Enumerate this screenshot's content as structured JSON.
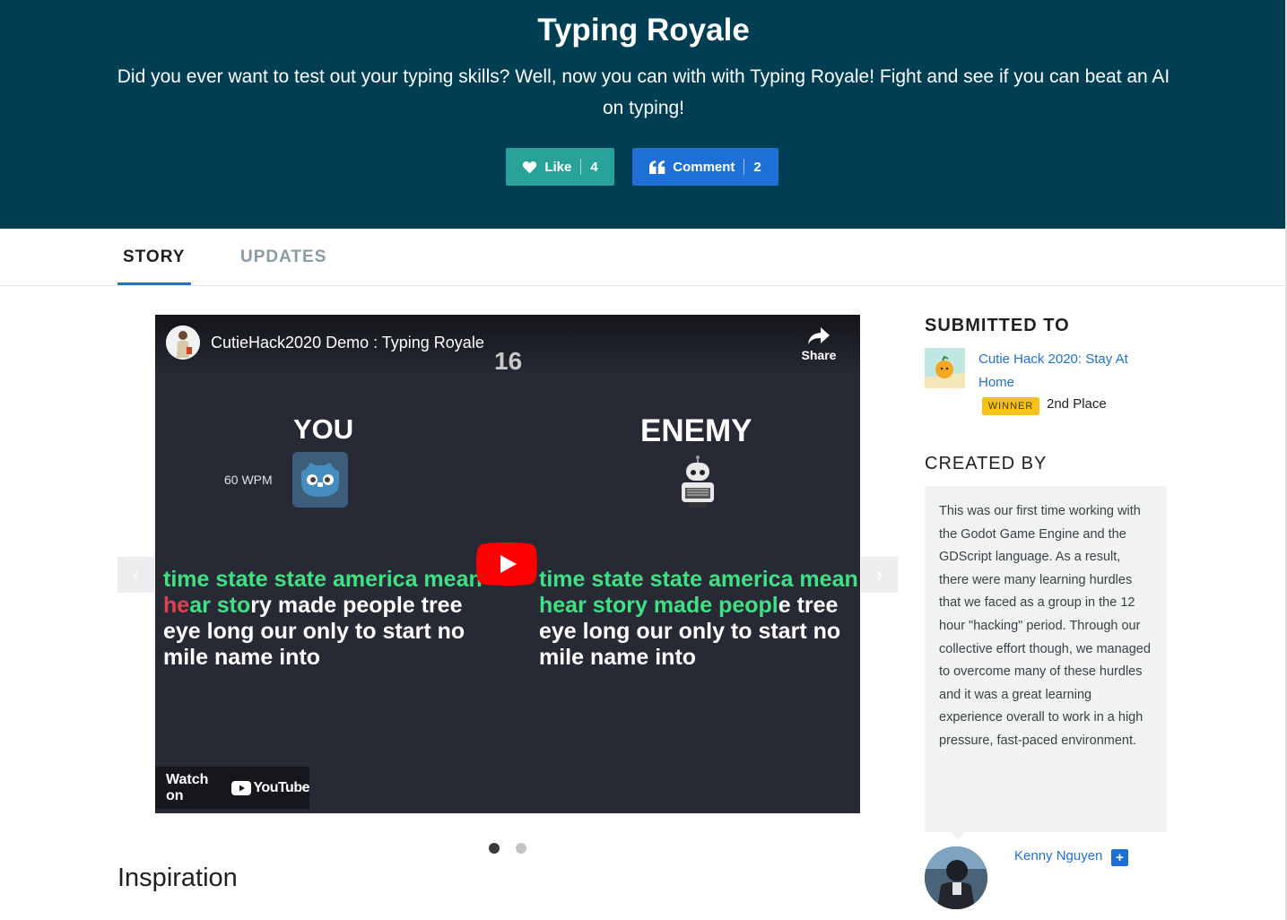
{
  "hero": {
    "title": "Typing Royale",
    "tagline": "Did you ever want to test out your typing skills? Well, now you can with with Typing Royale! Fight and see if you can beat an AI on typing!",
    "like_label": "Like",
    "like_count": "4",
    "comment_label": "Comment",
    "comment_count": "2",
    "background_color": "#003e54"
  },
  "tabs": [
    {
      "label": "STORY",
      "active": true
    },
    {
      "label": "UPDATES",
      "active": false
    }
  ],
  "video": {
    "title": "CutieHack2020 Demo : Typing Royale",
    "share_label": "Share",
    "timer": "16",
    "you_label": "YOU",
    "enemy_label": "ENEMY",
    "wpm": "60 WPM",
    "watch_on": "Watch on",
    "youtube_label": "YouTube",
    "player_text_left": {
      "line1": "time state state america mean",
      "line2_red": "he",
      "line2_green": "ar sto",
      "line2_rest": "ry made people tree",
      "line3": "eye long our only to start no",
      "line4": "mile name into"
    },
    "player_text_right": {
      "line1": "time state state america mean",
      "line2_green": "hear story made peopl",
      "line2_rest": "e tree",
      "line3": "eye long our only to start no",
      "line4": "mile name into"
    }
  },
  "gallery": {
    "slide_count": 2,
    "active_slide": 1
  },
  "story": {
    "section_title": "Inspiration"
  },
  "sidebar": {
    "submitted_heading": "SUBMITTED TO",
    "hackathon_name": "Cutie Hack 2020: Stay At Home",
    "winner_badge": "WINNER",
    "place": "2nd Place",
    "created_heading": "CREATED BY",
    "bio": "This was our first time working with the Godot Game Engine and the GDScript language. As a result, there were many learning hurdles that we faced as a group in the 12 hour \"hacking\" period. Through our collective effort though, we managed to overcome many of these hurdles and it was a great learning experience overall to work in a high pressure, fast-paced environment.",
    "member_name": "Kenny Nguyen",
    "member_plus": "+"
  },
  "colors": {
    "accent_blue": "#1e70d6",
    "like_green": "#29a39a",
    "winner_yellow": "#f4c218",
    "typed_green": "#3fe183",
    "error_red": "#e0414f"
  }
}
